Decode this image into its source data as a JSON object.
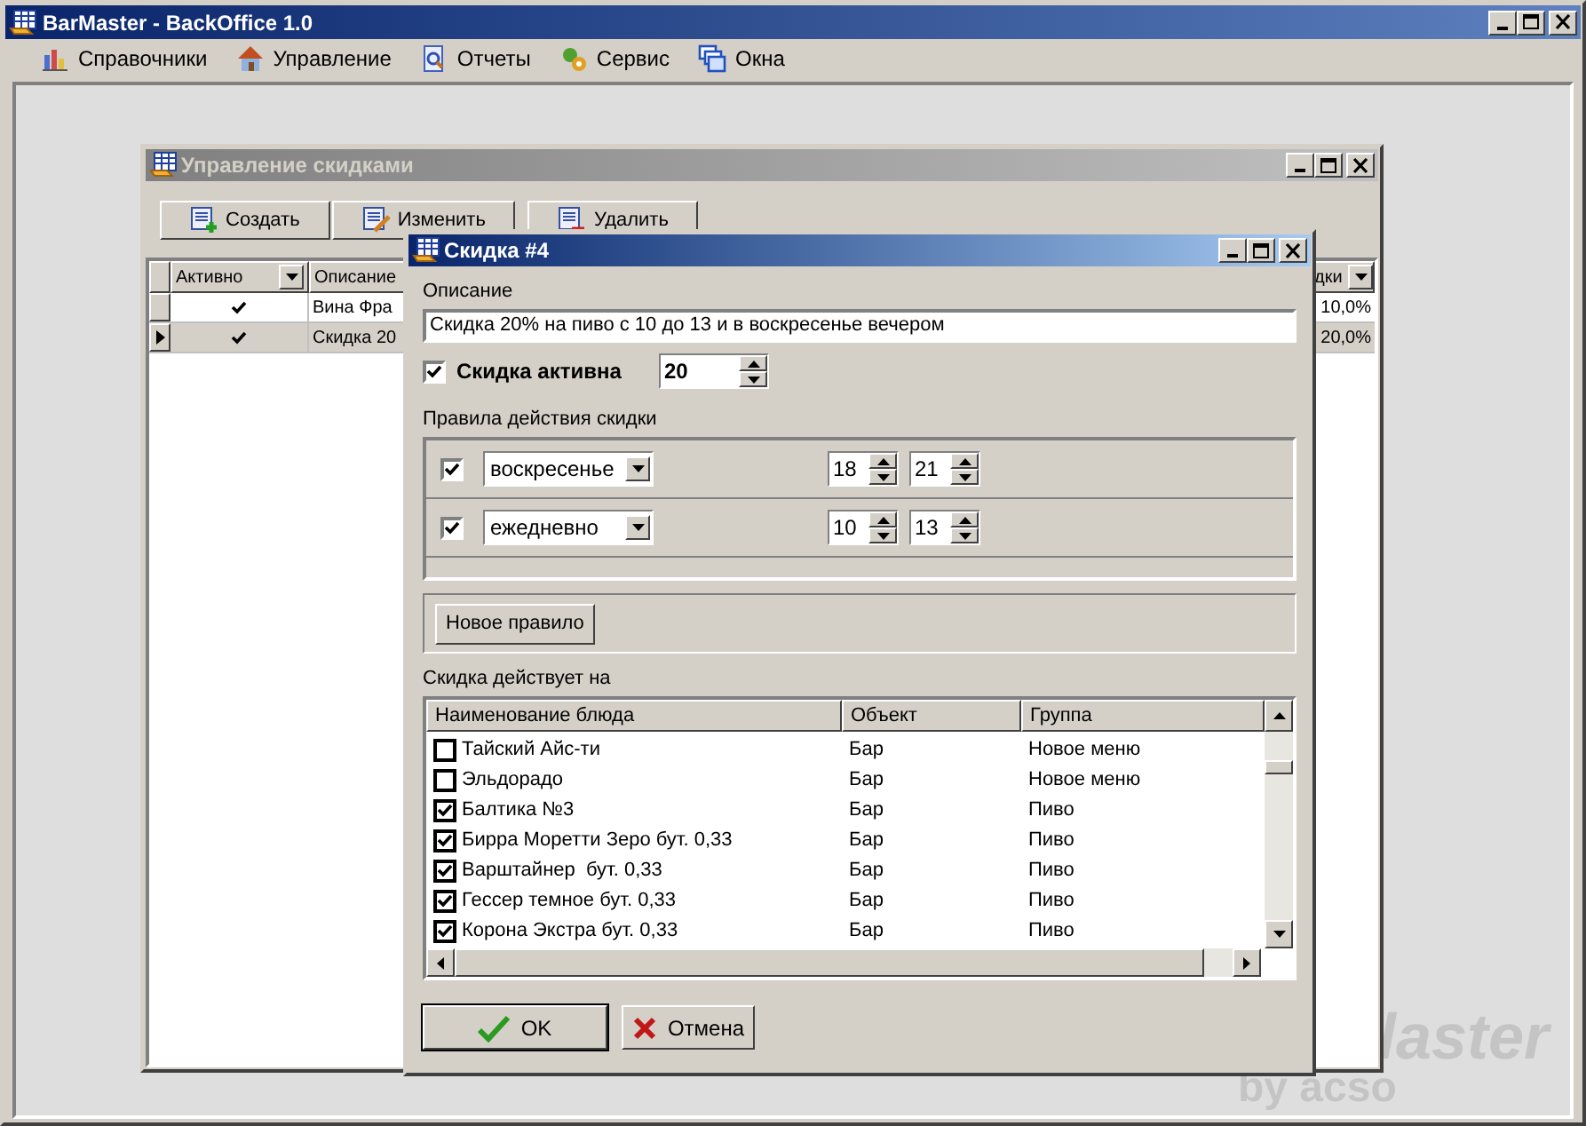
{
  "app": {
    "title": "BarMaster - BackOffice 1.0",
    "menu": [
      "Справочники",
      "Управление",
      "Отчеты",
      "Сервис",
      "Окна"
    ]
  },
  "background_logo": {
    "text": "laster",
    "subtext": "by acso"
  },
  "discounts_window": {
    "title": "Управление скидками",
    "toolbar": [
      {
        "kind": "create",
        "label": "Создать"
      },
      {
        "kind": "edit",
        "label": "Изменить"
      },
      {
        "kind": "delete",
        "label": "Удалить"
      }
    ],
    "grid": {
      "columns": [
        "Активно",
        "Описание",
        "дки"
      ],
      "rows": [
        {
          "active": true,
          "description": "Вина Фра",
          "value": "10,0%",
          "selected": false
        },
        {
          "active": true,
          "description": "Скидка 20",
          "value": "20,0%",
          "selected": true
        }
      ]
    }
  },
  "dialog": {
    "title": "Скидка #4",
    "description_label": "Описание",
    "description": "Скидка 20% на пиво с 10 до 13 и в воскресенье вечером",
    "active_label": "Скидка активна",
    "active": true,
    "percent": "20",
    "rules_label": "Правила действия скидки",
    "rules": [
      {
        "checked": true,
        "day": "воскресенье",
        "from": "18",
        "to": "21"
      },
      {
        "checked": true,
        "day": "ежедневно",
        "from": "10",
        "to": "13"
      }
    ],
    "new_rule_button": "Новое правило",
    "applies_label": "Скидка действует на",
    "table": {
      "columns": [
        "Наименование блюда",
        "Объект",
        "Группа"
      ],
      "rows": [
        {
          "checked": false,
          "name": "Тайский Айс-ти",
          "object": "Бар",
          "group": "Новое меню"
        },
        {
          "checked": false,
          "name": "Эльдорадо",
          "object": "Бар",
          "group": "Новое меню"
        },
        {
          "checked": true,
          "name": "Балтика №3",
          "object": "Бар",
          "group": "Пиво"
        },
        {
          "checked": true,
          "name": "Бирра Моретти Зеро бут. 0,33",
          "object": "Бар",
          "group": "Пиво"
        },
        {
          "checked": true,
          "name": "Варштайнер  бут. 0,33",
          "object": "Бар",
          "group": "Пиво"
        },
        {
          "checked": true,
          "name": "Гессер темное бут. 0,33",
          "object": "Бар",
          "group": "Пиво"
        },
        {
          "checked": true,
          "name": "Корона Экстра бут. 0,33",
          "object": "Бар",
          "group": "Пиво"
        }
      ]
    },
    "buttons": [
      {
        "kind": "ok",
        "label": "OK"
      },
      {
        "kind": "cancel",
        "label": "Отмена"
      }
    ]
  }
}
